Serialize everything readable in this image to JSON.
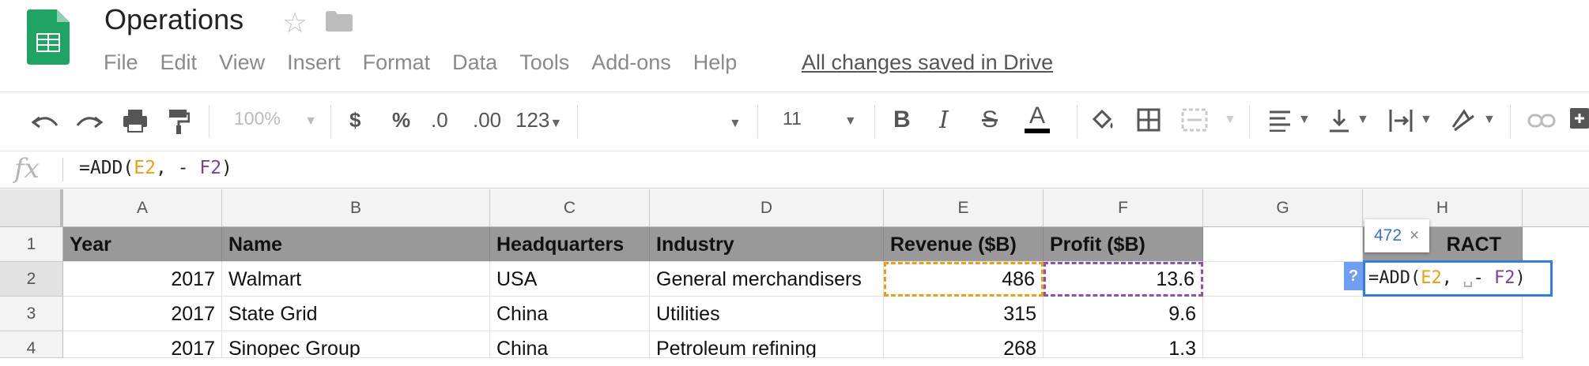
{
  "doc": {
    "title": "Operations",
    "saved_status": "All changes saved in Drive"
  },
  "menu": [
    "File",
    "Edit",
    "View",
    "Insert",
    "Format",
    "Data",
    "Tools",
    "Add-ons",
    "Help"
  ],
  "toolbar": {
    "zoom": "100%",
    "currency": "$",
    "percent": "%",
    "dec_less": ".0",
    "dec_more": ".00",
    "more_formats": "123",
    "font_size": "11",
    "bold": "B",
    "italic": "I",
    "strike": "S",
    "text_color": "A"
  },
  "formula_bar": {
    "fx": "fx",
    "prefix": "=ADD(",
    "ref1": "E2",
    "middle": ", - ",
    "ref2": "F2",
    "suffix": ")"
  },
  "columns": [
    "A",
    "B",
    "C",
    "D",
    "E",
    "F",
    "G",
    "H"
  ],
  "rows": [
    "1",
    "2",
    "3",
    "4"
  ],
  "header_row": [
    "Year",
    "Name",
    "Headquarters",
    "Industry",
    "Revenue ($B)",
    "Profit ($B)"
  ],
  "header_h_partial": "RACT",
  "data_rows": [
    [
      "2017",
      "Walmart",
      "USA",
      "General merchandisers",
      "486",
      "13.6"
    ],
    [
      "2017",
      "State Grid",
      "China",
      "Utilities",
      "315",
      "9.6"
    ],
    [
      "2017",
      "Sinopec Group",
      "China",
      "Petroleum refining",
      "268",
      "1.3"
    ]
  ],
  "tooltip": {
    "value": "472",
    "close": "×",
    "help": "?"
  },
  "editor": {
    "prefix": "=ADD(",
    "ref1": "E2",
    "middle": ", ",
    "cursor": "␣",
    "minus": "- ",
    "ref2": "F2",
    "suffix": ")"
  },
  "colors": {
    "ref_e": "#f29c0e",
    "ref_f": "#8e4fb3",
    "editor_border": "#2f7ee8",
    "header_fill": "#999999"
  }
}
